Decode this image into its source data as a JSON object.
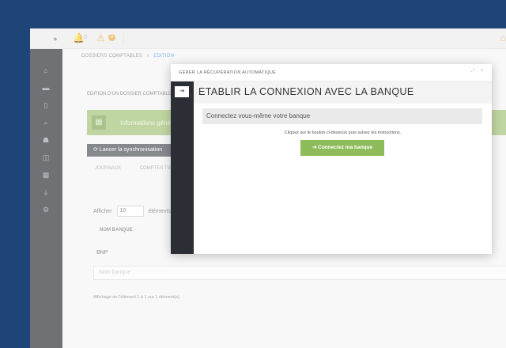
{
  "topbar": {
    "bell_count": "0",
    "warn_count": "0"
  },
  "breadcrumb": {
    "root": "DOSSIERS COMPTABLES",
    "separator": "›",
    "current": "EDITION"
  },
  "page": {
    "title": "EDITION D'UN DOSSIER COMPTABLE",
    "banner_text": "Informations géné",
    "sync_label": "⟳ Lancer la synchronisation",
    "tabs": [
      "JOURNAUX",
      "COMPTES TIE"
    ],
    "show_label": "Afficher",
    "show_value": "10",
    "show_suffix": "éléments",
    "table_header": "NOM BANQUE",
    "table_row": "BNP",
    "filter_placeholder": "Nom banque",
    "footer": "Affichage de l'élément 1 à 1 sur 1 élément(s)"
  },
  "modal": {
    "title": "GÉRER LA RÉCUPÉRATION AUTOMATIQUE",
    "expand_icon": "⤢",
    "close_icon": "×",
    "side_icon": "⇥",
    "heading": "ETABLIR LA CONNEXION AVEC LA BANQUE",
    "section": "Connectez vous-même votre banque",
    "instructions": "Cliquez sur le bouton ci-dessous puis suivez les instructions.",
    "connect_label": "⇥ Connectez ma banque"
  },
  "colors": {
    "background": "#1f4477",
    "accent_green": "#8fbc5a",
    "sidebar": "#23262b"
  }
}
